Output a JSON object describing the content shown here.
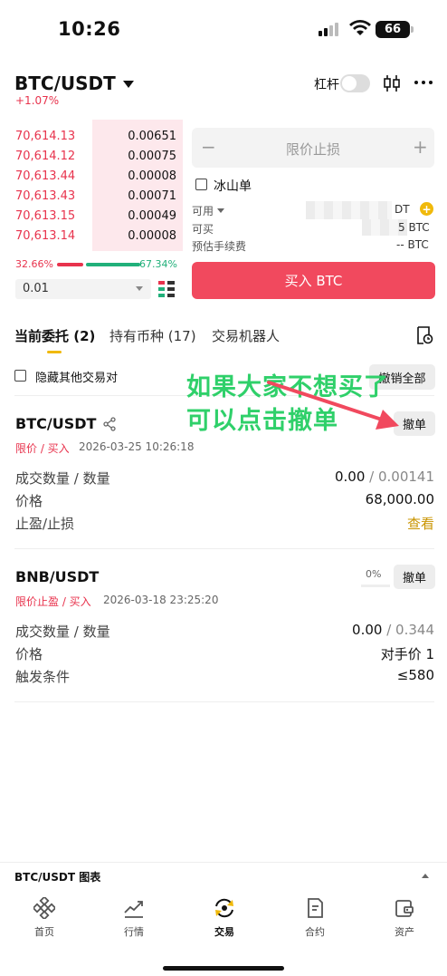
{
  "status_bar": {
    "time": "10:26",
    "battery": "66"
  },
  "header": {
    "pair": "BTC/USDT",
    "change": "+1.07%",
    "leverage_label": "杠杆"
  },
  "orderbook": {
    "rows": [
      {
        "price": "70,614.13",
        "qty": "0.00651"
      },
      {
        "price": "70,614.12",
        "qty": "0.00075"
      },
      {
        "price": "70,613.44",
        "qty": "0.00008"
      },
      {
        "price": "70,613.43",
        "qty": "0.00071"
      },
      {
        "price": "70,613.15",
        "qty": "0.00049"
      },
      {
        "price": "70,613.14",
        "qty": "0.00008"
      }
    ],
    "buy_ratio": "32.66%",
    "sell_ratio": "67.34%",
    "buy_fraction": 0.3266,
    "depth": "0.01"
  },
  "form": {
    "minus": "−",
    "plus": "+",
    "order_type": "限价止损",
    "iceberg": "冰山单",
    "available_label": "可用",
    "available_unit": "DT",
    "can_buy_label": "可买",
    "can_buy_value": "5 BTC",
    "fee_label": "预估手续费",
    "fee_value": "-- BTC",
    "buy_button": "买入 BTC"
  },
  "tabs": {
    "open_orders": "当前委托 (2)",
    "holdings": "持有币种 (17)",
    "bots": "交易机器人"
  },
  "filter": {
    "hide_other": "隐藏其他交易对",
    "cancel_all": "撤销全部"
  },
  "orders": [
    {
      "pair": "BTC/USDT",
      "type": "限价 / 买入",
      "time": "2026-03-25 10:26:18",
      "cancel": "撤单",
      "rows": [
        {
          "label": "成交数量 / 数量",
          "filled": "0.00",
          "total": " / 0.00141"
        },
        {
          "label": "价格",
          "value": "68,000.00"
        },
        {
          "label": "止盈/止损",
          "value": "查看"
        }
      ]
    },
    {
      "pair": "BNB/USDT",
      "type": "限价止盈 / 买入",
      "time": "2026-03-18 23:25:20",
      "cancel": "撤单",
      "progress": "0%",
      "rows": [
        {
          "label": "成交数量 / 数量",
          "filled": "0.00",
          "total": " / 0.344"
        },
        {
          "label": "价格",
          "value": "对手价 1"
        },
        {
          "label": "触发条件",
          "value": "≤580"
        }
      ]
    }
  ],
  "annotation": {
    "line1": "如果大家不想买了",
    "line2": "可以点击撤单"
  },
  "chart_bar": {
    "label": "BTC/USDT 图表"
  },
  "nav": [
    "首页",
    "行情",
    "交易",
    "合约",
    "资产"
  ],
  "colors": {
    "red": "#e8334d",
    "green": "#21b07a",
    "gold": "#f0b90b",
    "annotation": "#2fd06a"
  }
}
